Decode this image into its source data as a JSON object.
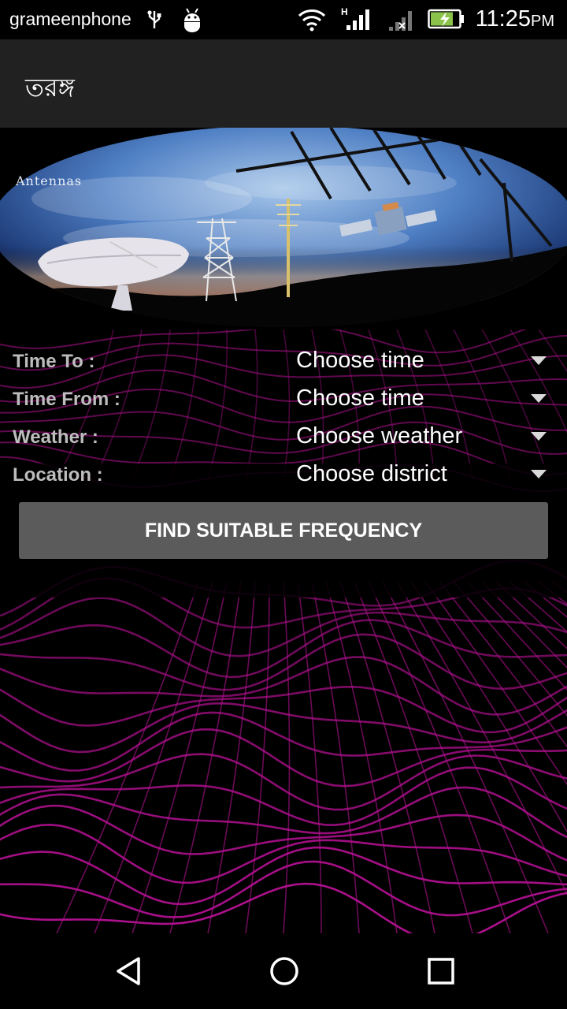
{
  "status_bar": {
    "carrier": "grameenphone",
    "network_type": "H",
    "time": "11:25",
    "ampm": "PM",
    "icons": [
      "usb-icon",
      "android-debug-icon",
      "wifi-icon",
      "signal-icon",
      "no-signal-icon",
      "battery-charging-icon"
    ]
  },
  "app_bar": {
    "title": "তরঙ্গ"
  },
  "banner": {
    "caption": "Antennas"
  },
  "form": {
    "time_to": {
      "label": "Time To :",
      "value": "Choose time"
    },
    "time_from": {
      "label": "Time From :",
      "value": "Choose time"
    },
    "weather": {
      "label": "Weather :",
      "value": "Choose weather"
    },
    "location": {
      "label": "Location :",
      "value": "Choose district"
    },
    "submit_label": "FIND SUITABLE FREQUENCY"
  },
  "nav_bar": {
    "buttons": [
      "back-icon",
      "home-icon",
      "recents-icon"
    ]
  },
  "colors": {
    "status_bar_bg": "#000000",
    "app_bar_bg": "#212121",
    "button_bg": "#5b5b5b",
    "label_color": "#bdbdbd",
    "wave_color": "#b0108f"
  }
}
